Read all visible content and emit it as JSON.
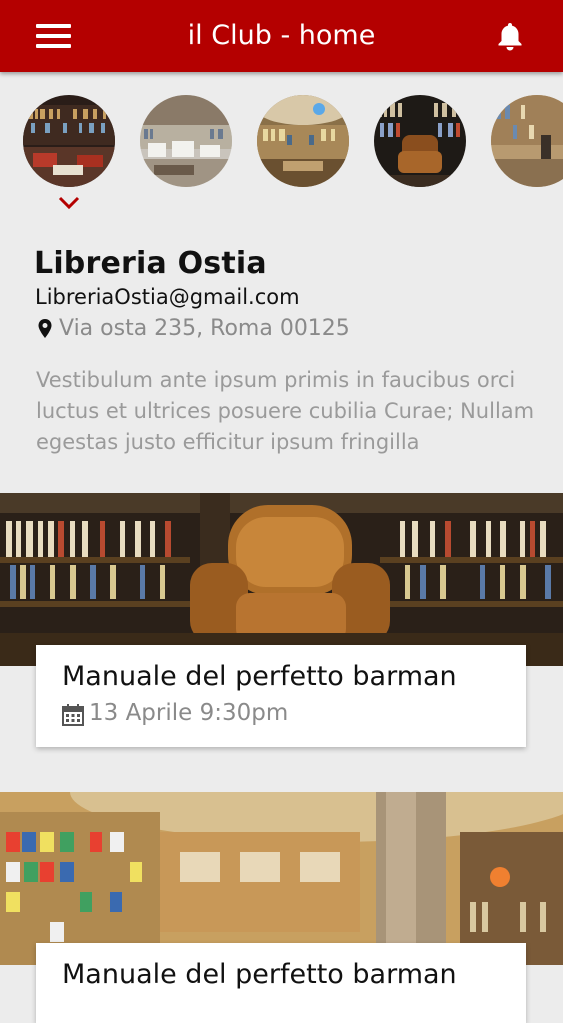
{
  "app": {
    "title": "il Club - home"
  },
  "icons": {
    "menu": "menu-icon",
    "notifications": "bell-icon",
    "location": "map-pin-icon",
    "calendar": "calendar-icon",
    "selected": "chevron-down-icon"
  },
  "colors": {
    "accent": "#b40000",
    "background": "#ececec",
    "card": "#ffffff",
    "muted_text": "#8a8a8a"
  },
  "stories": [
    {
      "name": "story-library-1",
      "selected": true
    },
    {
      "name": "story-library-2",
      "selected": false
    },
    {
      "name": "story-library-3",
      "selected": false
    },
    {
      "name": "story-library-4",
      "selected": false
    },
    {
      "name": "story-library-5",
      "selected": false
    }
  ],
  "profile": {
    "name": "Libreria Ostia",
    "email": "LibreriaOstia@gmail.com",
    "address": "Via osta 235, Roma 00125",
    "description": "Vestibulum ante ipsum primis in faucibus orci luctus et ultrices posuere cubilia Curae; Nullam egestas justo efficitur ipsum fringilla"
  },
  "events": [
    {
      "title": "Manuale del perfetto barman",
      "date": "13 Aprile 9:30pm"
    },
    {
      "title": "Manuale del perfetto barman"
    }
  ]
}
